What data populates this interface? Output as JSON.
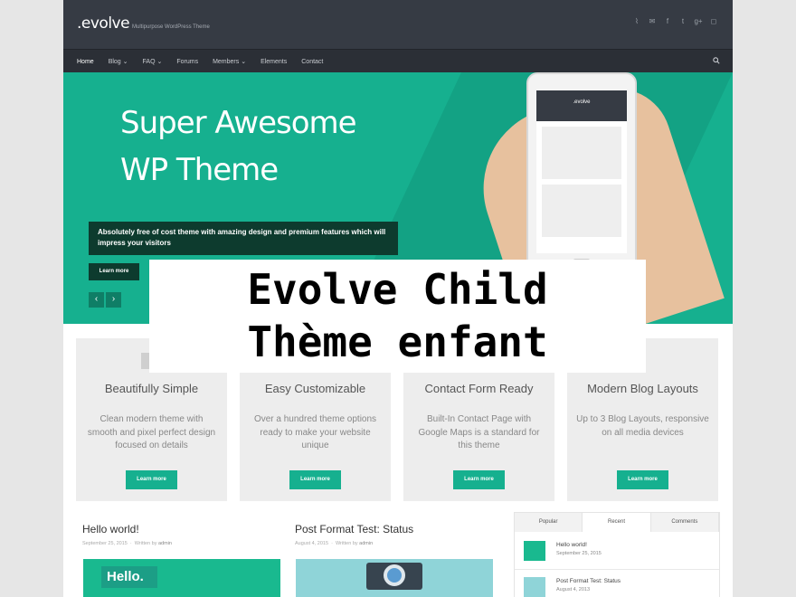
{
  "header": {
    "logo": ".evolve",
    "tagline": "Multipurpose WordPress Theme",
    "social_icons": [
      "rss-icon",
      "email-icon",
      "facebook-icon",
      "twitter-icon",
      "google-plus-icon",
      "instagram-icon"
    ]
  },
  "nav": {
    "items": [
      {
        "label": "Home",
        "active": true
      },
      {
        "label": "Blog ⌄"
      },
      {
        "label": "FAQ ⌄"
      },
      {
        "label": "Forums"
      },
      {
        "label": "Members ⌄"
      },
      {
        "label": "Elements"
      },
      {
        "label": "Contact"
      }
    ]
  },
  "hero": {
    "title_line1": "Super Awesome",
    "title_line2": "WP Theme",
    "description": "Absolutely free of cost theme with amazing design and premium features which will impress your visitors",
    "button": "Learn more",
    "prev": "‹",
    "next": "›",
    "phone_logo": ".evolve"
  },
  "overlay": {
    "line1": "Evolve Child",
    "line2": "Thème enfant"
  },
  "features": [
    {
      "title": "Beautifully Simple",
      "text": "Clean modern theme with smooth and pixel perfect design focused on details",
      "button": "Learn more"
    },
    {
      "title": "Easy Customizable",
      "text": "Over a hundred theme options ready to make your website unique",
      "button": "Learn more"
    },
    {
      "title": "Contact Form Ready",
      "text": "Built-In Contact Page with Google Maps is a standard for this theme",
      "button": "Learn more"
    },
    {
      "title": "Modern Blog Layouts",
      "text": "Up to 3 Blog Layouts, responsive on all media devices",
      "button": "Learn more"
    }
  ],
  "posts": [
    {
      "title": "Hello world!",
      "date": "September 25, 2015",
      "by": "Written by",
      "author": "admin",
      "thumb_text": "Hello."
    },
    {
      "title": "Post Format Test: Status",
      "date": "August 4, 2015",
      "by": "Written by",
      "author": "admin"
    }
  ],
  "widget": {
    "tabs": [
      "Popular",
      "Recent",
      "Comments"
    ],
    "items": [
      {
        "title": "Hello world!",
        "date": "September 25, 2015"
      },
      {
        "title": "Post Format Test: Status",
        "date": "August 4, 2013"
      }
    ]
  },
  "colors": {
    "accent": "#16b08f",
    "header": "#363b44",
    "nav": "#2b2f36",
    "dark_green": "#0d3b2e"
  }
}
